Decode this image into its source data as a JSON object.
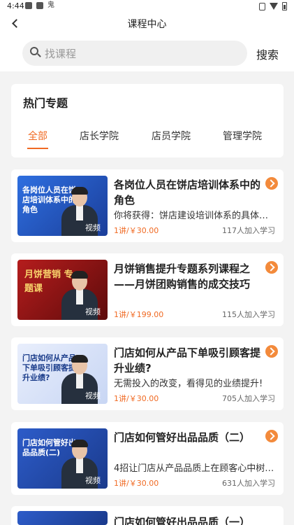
{
  "status_bar": {
    "time": "4:44",
    "icons_left": [
      "notification-icon",
      "a-icon",
      "鬼"
    ],
    "icons_right": [
      "vibrate-icon",
      "wifi-icon",
      "battery-icon"
    ]
  },
  "nav": {
    "title": "课程中心"
  },
  "search": {
    "placeholder": "找课程",
    "button": "搜索"
  },
  "topics": {
    "title": "热门专题",
    "tabs": [
      "全部",
      "店长学院",
      "店员学院",
      "管理学院"
    ],
    "active_tab": 0
  },
  "colors": {
    "accent": "#f06a23",
    "arrow": "#f38a3b"
  },
  "courses": [
    {
      "thumb_text": "各岗位人员在饼店培训体系中的角色",
      "badge": "视频",
      "title": "各岗位人员在饼店培训体系中的角色",
      "subtitle": "你将获得：饼店建设培训体系的具体…",
      "price": "1讲/￥30.00",
      "learners": "117人加入学习"
    },
    {
      "thumb_text": "月饼营销 专题课",
      "badge": "视频",
      "title": "月饼销售提升专题系列课程之——月饼团购销售的成交技巧",
      "subtitle": "",
      "price": "1讲/￥199.00",
      "learners": "115人加入学习"
    },
    {
      "thumb_text": "门店如何从产品下单吸引顾客提升业绩?",
      "badge": "视频",
      "title": "门店如何从产品下单吸引顾客提升业绩?",
      "subtitle": "无需投入的改变，看得见的业绩提升!",
      "price": "1讲/￥30.00",
      "learners": "705人加入学习"
    },
    {
      "thumb_text": "门店如何管好出品品质(二)",
      "badge": "视频",
      "title": "门店如何管好出品品质（二）",
      "subtitle": "4招让门店从产品品质上在顾客心中树…",
      "price": "1讲/￥30.00",
      "learners": "631人加入学习"
    },
    {
      "thumb_text": "",
      "badge": "",
      "title": "门店如何管好出品品质（一）",
      "subtitle": "",
      "price": "",
      "learners": ""
    }
  ]
}
